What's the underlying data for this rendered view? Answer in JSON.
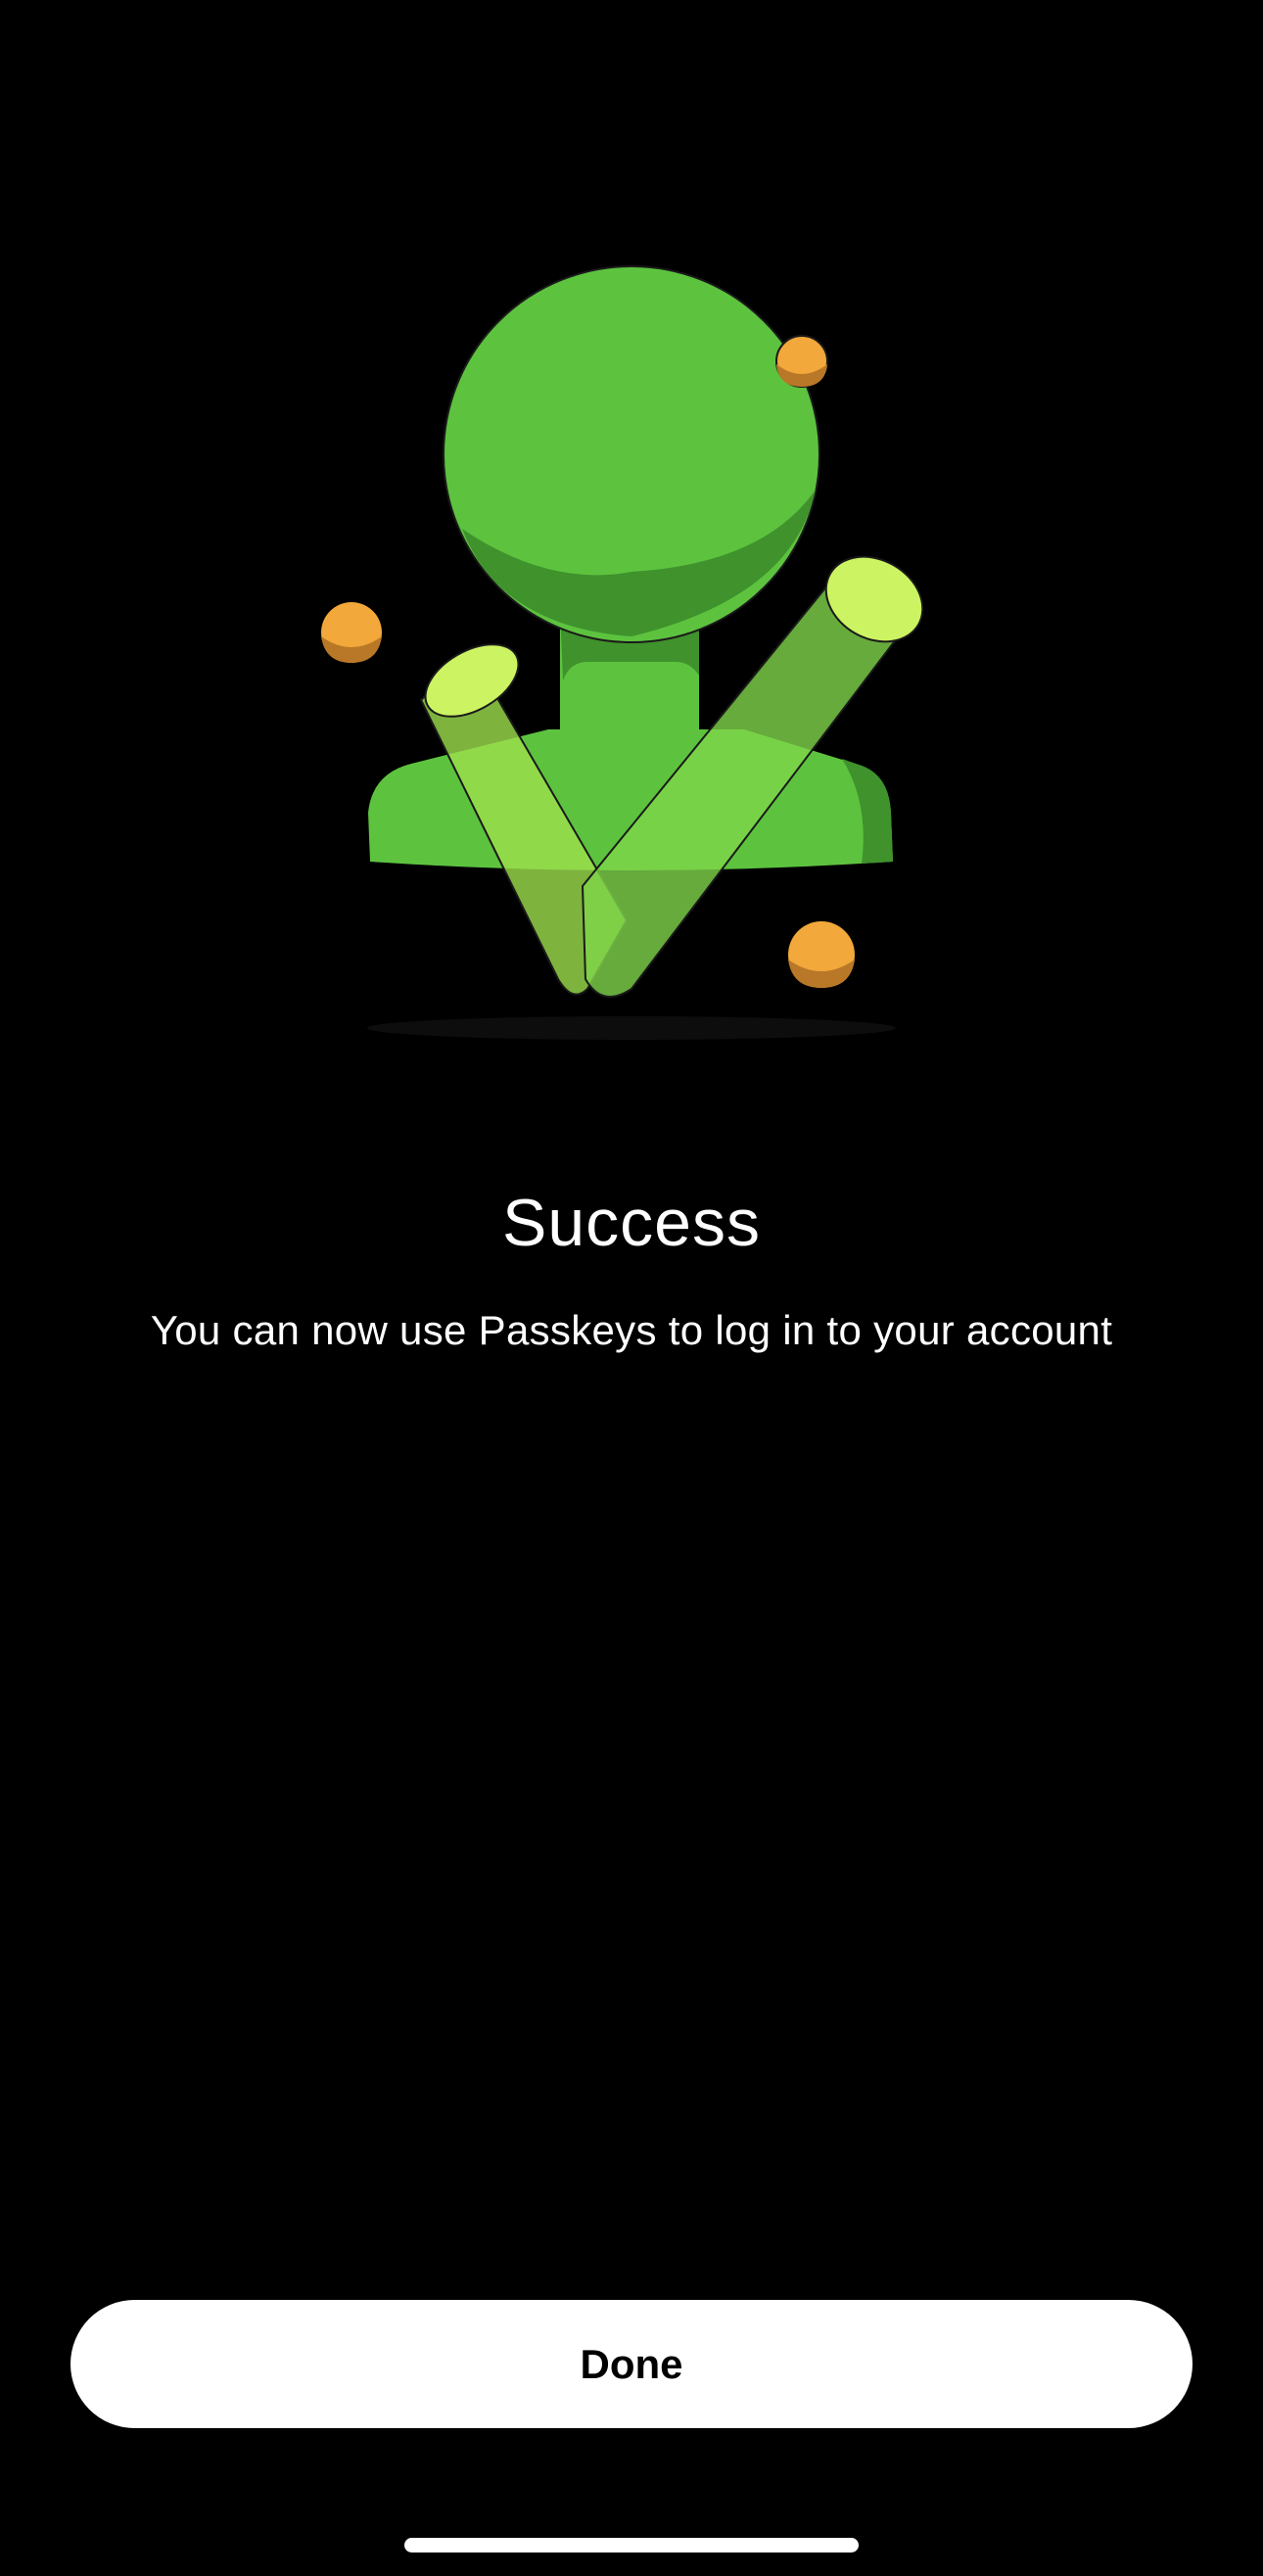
{
  "screen": {
    "title": "Success",
    "message": "You can now use Passkeys to log in to your account"
  },
  "illustration": {
    "icon": "user-checkmark-icon",
    "colors": {
      "green": "#5DC33F",
      "green_dark": "#3F922C",
      "lime": "#CCF462",
      "orange": "#F2A83A",
      "orange_dark": "#B97828"
    }
  },
  "actions": {
    "done_label": "Done"
  },
  "colors": {
    "background": "#000000",
    "text": "#FFFFFF",
    "button_bg": "#FFFFFF",
    "button_text": "#000000"
  }
}
